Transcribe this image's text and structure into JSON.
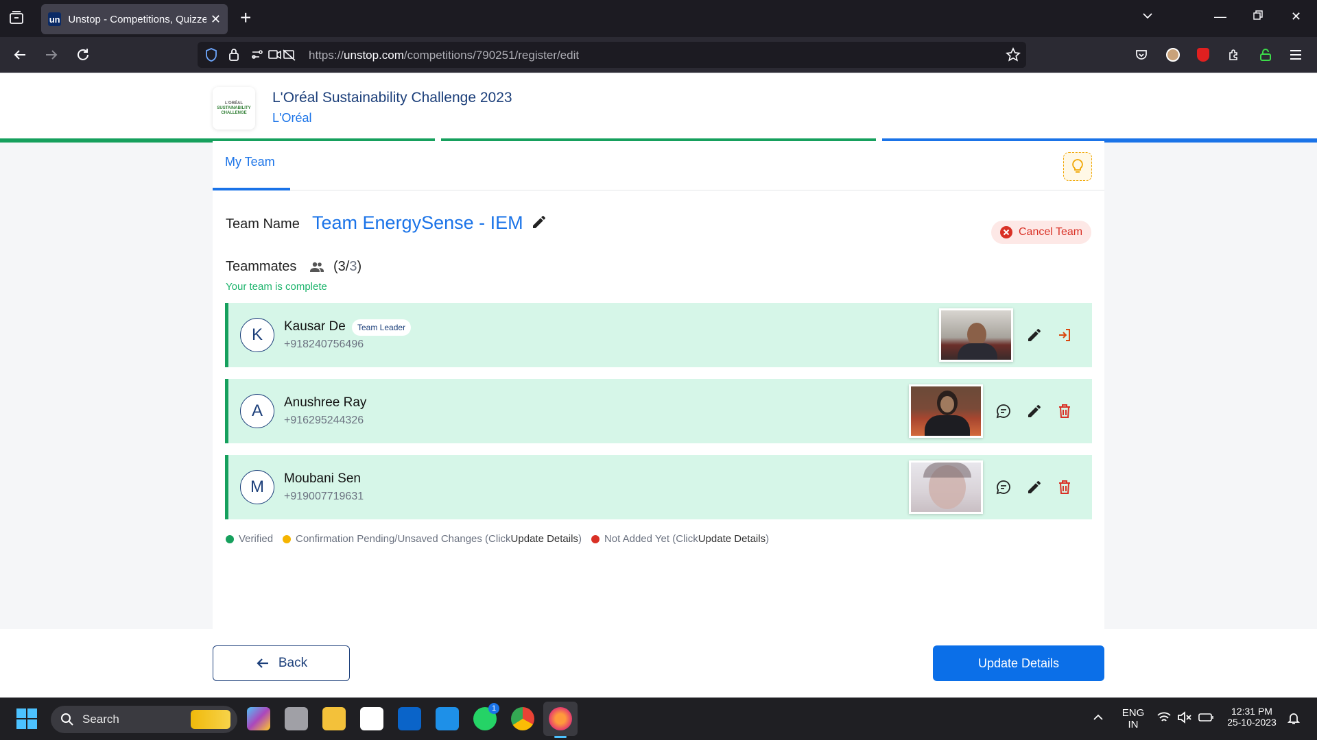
{
  "browser": {
    "tab_title": "Unstop - Competitions, Quizzes",
    "tab_favicon": "un",
    "url_prefix": "https://",
    "url_host": "unstop.com",
    "url_path": "/competitions/790251/register/edit"
  },
  "competition": {
    "logo_text_1": "L'ORÉAL",
    "logo_text_2": "SUSTAINABILITY",
    "logo_text_3": "CHALLENGE",
    "title": "L'Oréal Sustainability Challenge 2023",
    "organizer": "L'Oréal"
  },
  "tabs": {
    "my_team": "My Team"
  },
  "team": {
    "label": "Team Name",
    "name": "Team EnergySense - IEM",
    "cancel_label": "Cancel Team"
  },
  "teammates": {
    "label": "Teammates",
    "count_open": "(3/",
    "count_max": "3",
    "count_close": ")",
    "status": "Your team is complete",
    "members": [
      {
        "initial": "K",
        "name": "Kausar De",
        "phone": "+918240756496",
        "badge": "Team Leader"
      },
      {
        "initial": "A",
        "name": "Anushree Ray",
        "phone": "+916295244326"
      },
      {
        "initial": "M",
        "name": "Moubani Sen",
        "phone": "+919007719631"
      }
    ]
  },
  "legend": {
    "verified": "Verified",
    "pending_prefix": "Confirmation Pending/Unsaved Changes (Click ",
    "pending_link": "Update Details",
    "pending_suffix": " )",
    "notadded_prefix": "Not Added Yet (Click ",
    "notadded_link": "Update Details",
    "notadded_suffix": " )",
    "colors": {
      "verified": "#16a05d",
      "pending": "#f5b400",
      "notadded": "#d93025"
    }
  },
  "footer": {
    "back_label": "Back",
    "update_label": "Update Details"
  },
  "taskbar": {
    "search_label": "Search",
    "lang_1": "ENG",
    "lang_2": "IN",
    "time": "12:31 PM",
    "date": "25-10-2023",
    "whatsapp_badge": "1"
  }
}
